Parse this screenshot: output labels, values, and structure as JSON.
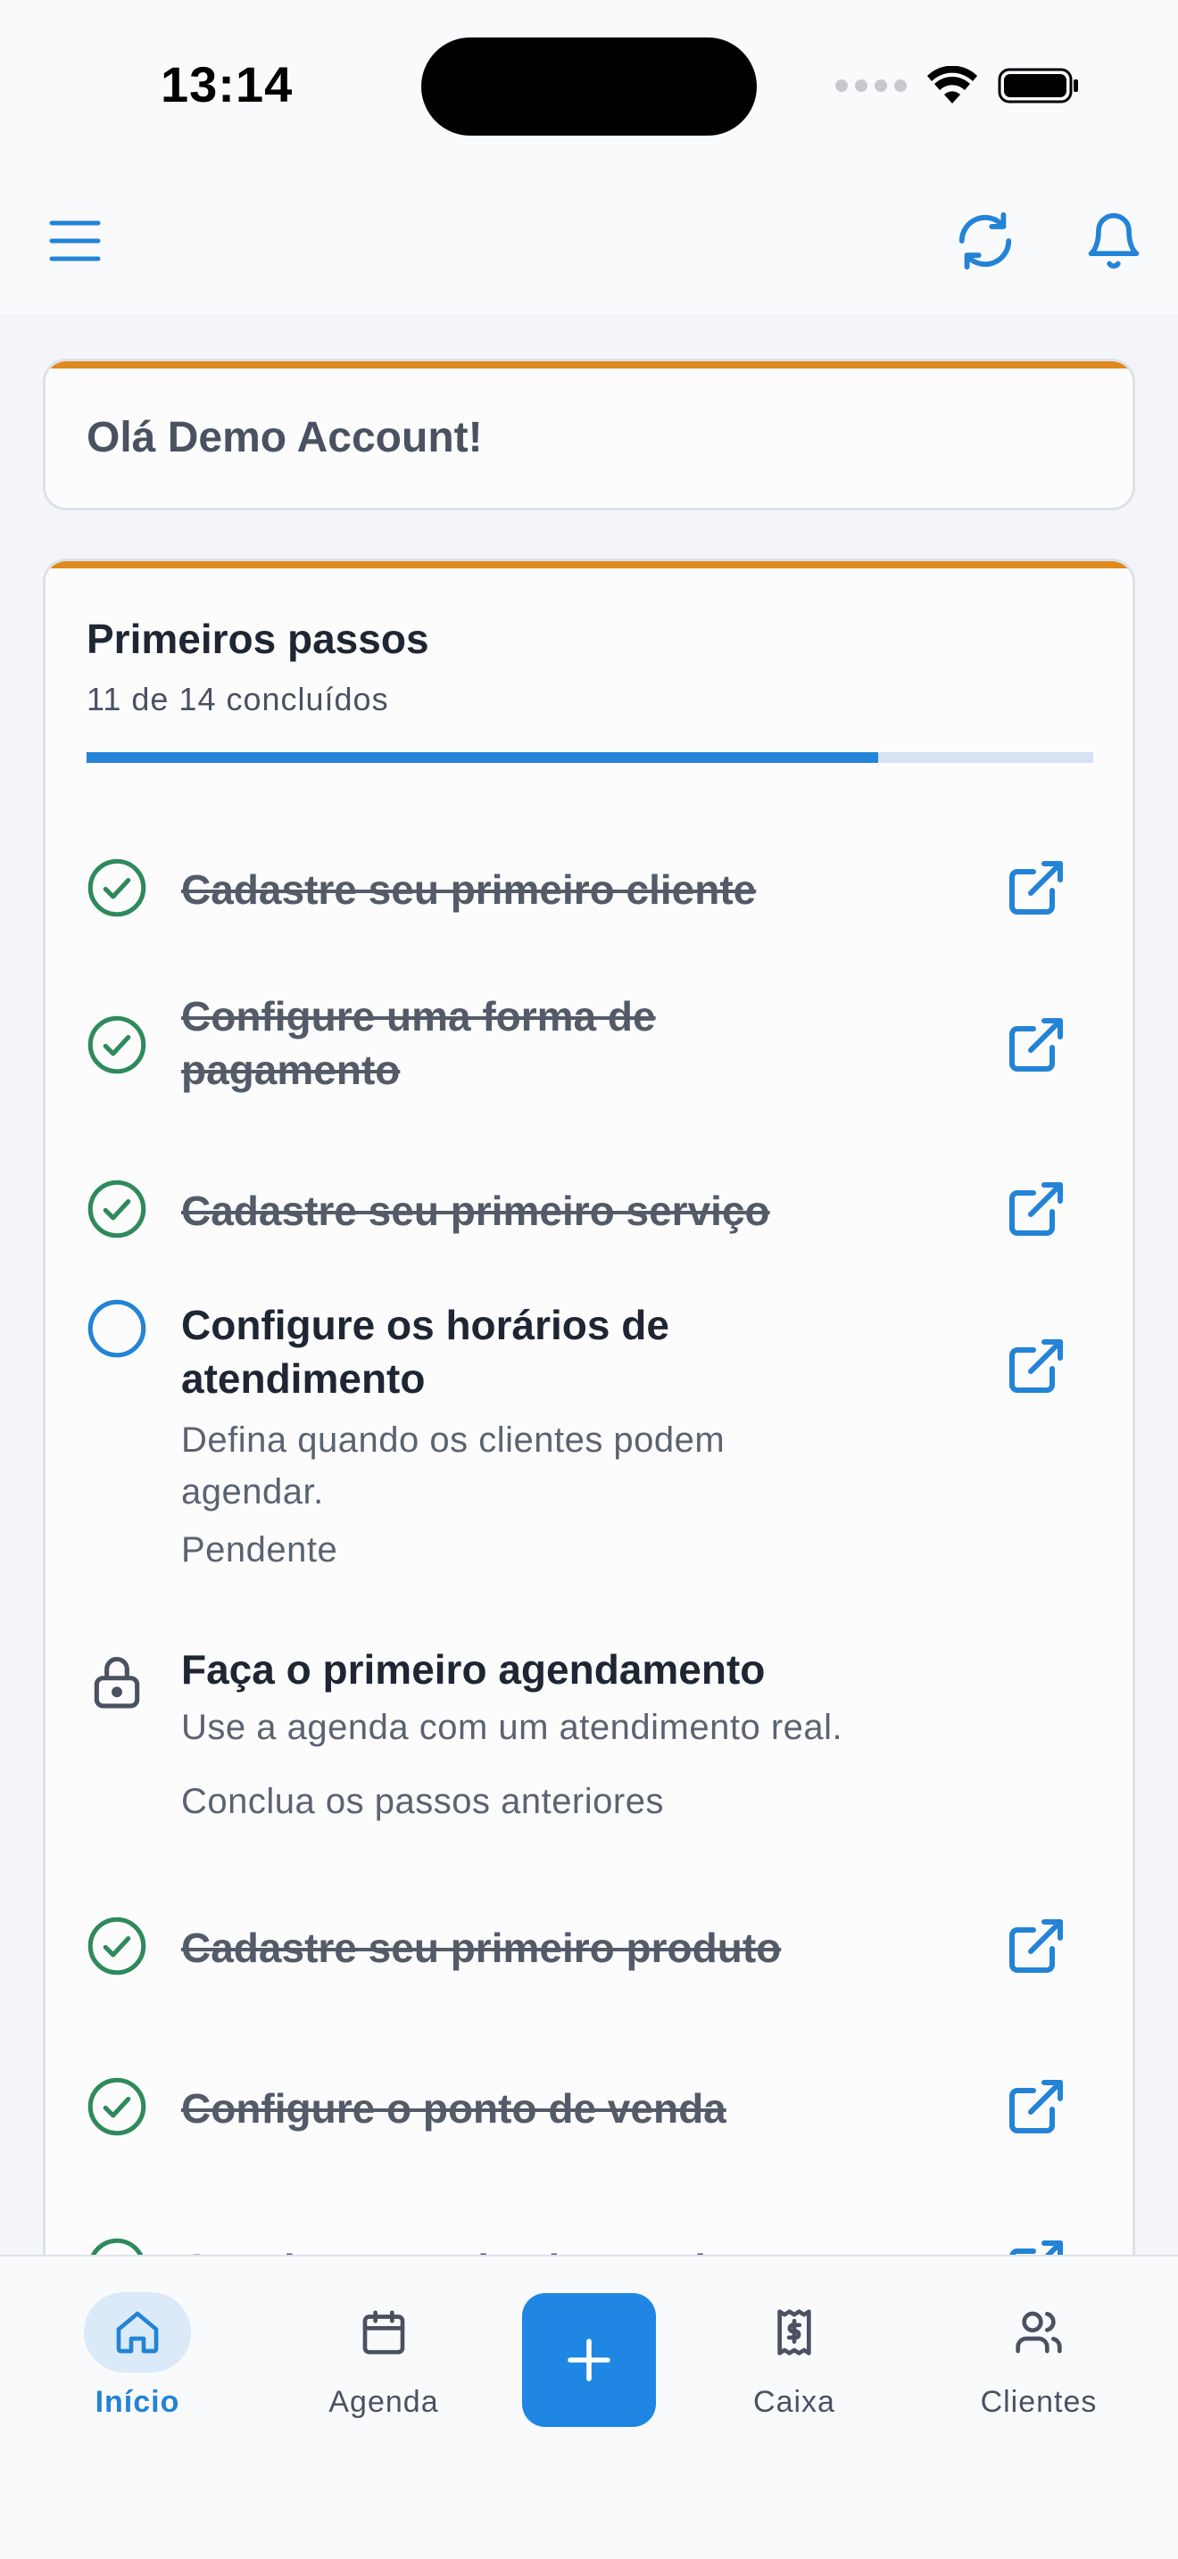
{
  "status_bar": {
    "time": "13:14"
  },
  "greeting": "Olá Demo Account!",
  "onboarding": {
    "title": "Primeiros passos",
    "progress_text": "11 de 14 concluídos",
    "progress_fraction": 0.786,
    "steps": [
      {
        "title": "Cadastre seu primeiro cliente",
        "state": "done"
      },
      {
        "title": "Configure uma forma de pagamento",
        "state": "done"
      },
      {
        "title": "Cadastre seu primeiro serviço",
        "state": "done"
      },
      {
        "title": "Configure os horários de atendimento",
        "state": "pending",
        "description": "Defina quando os clientes podem agendar.",
        "status": "Pendente"
      },
      {
        "title": "Faça o primeiro agendamento",
        "state": "locked",
        "description": "Use a agenda com um atendimento real.",
        "status": "Conclua os passos anteriores"
      },
      {
        "title": "Cadastre seu primeiro produto",
        "state": "done"
      },
      {
        "title": "Configure o ponto de venda",
        "state": "done"
      },
      {
        "title": "Conclua sua primeira venda",
        "state": "done"
      }
    ]
  },
  "tabbar": {
    "home": "Início",
    "agenda": "Agenda",
    "caixa": "Caixa",
    "clientes": "Clientes"
  },
  "colors": {
    "accent": "#2383d6",
    "success": "#2e8a5c",
    "card_top_border": "#e0891d"
  },
  "icons": [
    "menu-icon",
    "refresh-icon",
    "bell-icon",
    "check-circle-icon",
    "circle-icon",
    "lock-icon",
    "external-link-icon",
    "home-icon",
    "calendar-icon",
    "plus-icon",
    "receipt-icon",
    "users-icon"
  ]
}
